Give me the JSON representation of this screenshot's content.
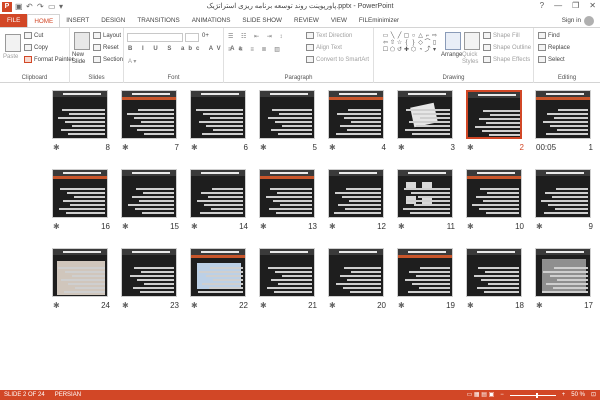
{
  "window": {
    "title": "پاورپوینت روند توسعه برنامه ریزی استراتژیک.pptx - PowerPoint",
    "controls": [
      "?",
      "—",
      "❐",
      "✕"
    ]
  },
  "tabs": [
    "FILE",
    "HOME",
    "INSERT",
    "DESIGN",
    "TRANSITIONS",
    "ANIMATIONS",
    "SLIDE SHOW",
    "REVIEW",
    "VIEW",
    "FILEminimizer"
  ],
  "active_tab": "HOME",
  "signin": "Sign in",
  "ribbon": {
    "clipboard": {
      "paste": "Paste",
      "cut": "Cut",
      "copy": "Copy",
      "format_painter": "Format Painter",
      "label": "Clipboard"
    },
    "slides": {
      "new_slide": "New Slide",
      "layout": "Layout",
      "reset": "Reset",
      "section": "Section",
      "label": "Slides"
    },
    "font": {
      "label": "Font",
      "size": "0+"
    },
    "paragraph": {
      "text_direction": "Text Direction",
      "align_text": "Align Text",
      "convert": "Convert to SmartArt",
      "label": "Paragraph"
    },
    "drawing": {
      "arrange": "Arrange",
      "quick_styles": "Quick Styles",
      "shape_fill": "Shape Fill",
      "shape_outline": "Shape Outline",
      "shape_effects": "Shape Effects",
      "label": "Drawing"
    },
    "editing": {
      "find": "Find",
      "replace": "Replace",
      "select": "Select",
      "label": "Editing"
    }
  },
  "slides": [
    {
      "n": "1",
      "time": "00:05"
    },
    {
      "n": "2"
    },
    {
      "n": "3"
    },
    {
      "n": "4"
    },
    {
      "n": "5"
    },
    {
      "n": "6"
    },
    {
      "n": "7"
    },
    {
      "n": "8"
    },
    {
      "n": "9"
    },
    {
      "n": "10"
    },
    {
      "n": "11"
    },
    {
      "n": "12"
    },
    {
      "n": "13"
    },
    {
      "n": "14"
    },
    {
      "n": "15"
    },
    {
      "n": "16"
    },
    {
      "n": "17"
    },
    {
      "n": "18"
    },
    {
      "n": "19"
    },
    {
      "n": "20"
    },
    {
      "n": "21"
    },
    {
      "n": "22"
    },
    {
      "n": "23"
    },
    {
      "n": "24"
    }
  ],
  "selected_slide": "2",
  "star_glyph": "✱",
  "status": {
    "slide": "SLIDE 2 OF 24",
    "language": "PERSIAN",
    "zoom": "50 %"
  },
  "colors": {
    "accent": "#d24726"
  }
}
